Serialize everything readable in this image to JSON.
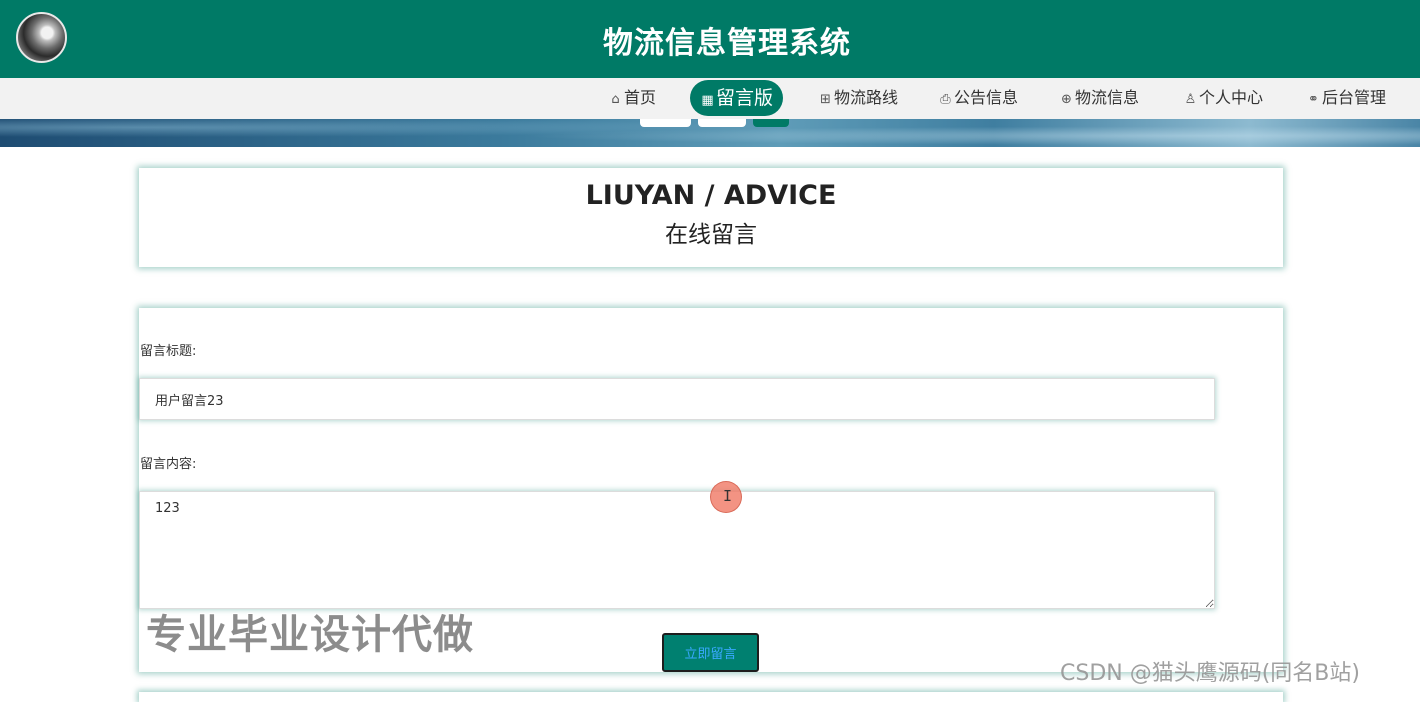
{
  "header": {
    "site_title": "物流信息管理系统",
    "color": "#007a66"
  },
  "nav": {
    "items": [
      {
        "label": "首页",
        "icon": "home-icon"
      },
      {
        "label": "留言版",
        "icon": "message-board-icon",
        "active": true
      },
      {
        "label": "物流路线",
        "icon": "route-icon"
      },
      {
        "label": "公告信息",
        "icon": "printer-icon"
      },
      {
        "label": "物流信息",
        "icon": "globe-icon"
      },
      {
        "label": "个人中心",
        "icon": "user-icon"
      },
      {
        "label": "后台管理",
        "icon": "link-icon"
      }
    ]
  },
  "section": {
    "title_en": "LIUYAN / ADVICE",
    "title_zh": "在线留言"
  },
  "form": {
    "title_label": "留言标题:",
    "title_value": "用户留言23",
    "content_label": "留言内容:",
    "content_value": "123",
    "submit_label": "立即留言"
  },
  "overlay": {
    "ad_text": "专业毕业设计代做",
    "csdn_text": "CSDN @猫头鹰源码(同名B站)",
    "cursor_glyph": "I"
  }
}
